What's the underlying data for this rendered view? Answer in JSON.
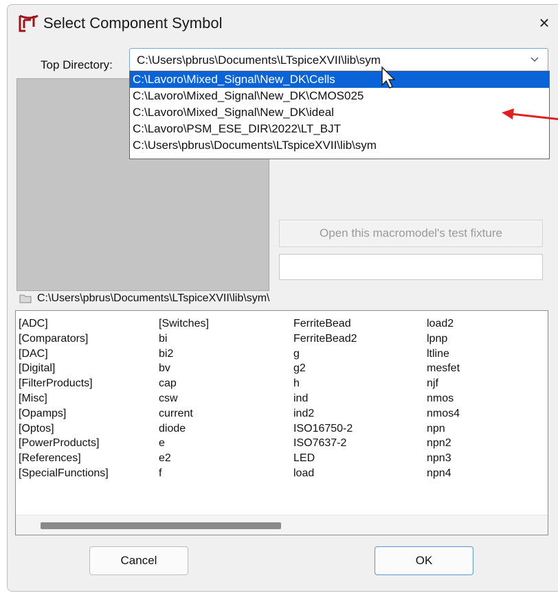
{
  "window": {
    "title": "Select Component Symbol",
    "close_glyph": "×"
  },
  "top_directory": {
    "label": "Top Directory:",
    "value": "C:\\Users\\pbrus\\Documents\\LTspiceXVII\\lib\\sym",
    "options": [
      "C:\\Lavoro\\Mixed_Signal\\New_DK\\Cells",
      "C:\\Lavoro\\Mixed_Signal\\New_DK\\CMOS025",
      "C:\\Lavoro\\Mixed_Signal\\New_DK\\ideal",
      "C:\\Lavoro\\PSM_ESE_DIR\\2022\\LT_BJT",
      "C:\\Users\\pbrus\\Documents\\LTspiceXVII\\lib\\sym"
    ],
    "highlighted_index": 0
  },
  "fixture_button": "Open this macromodel's test fixture",
  "current_path": "C:\\Users\\pbrus\\Documents\\LTspiceXVII\\lib\\sym\\",
  "file_columns": [
    [
      "[ADC]",
      "[Comparators]",
      "[DAC]",
      "[Digital]",
      "[FilterProducts]",
      "[Misc]",
      "[Opamps]",
      "[Optos]",
      "[PowerProducts]",
      "[References]",
      "[SpecialFunctions]"
    ],
    [
      "[Switches]",
      "bi",
      "bi2",
      "bv",
      "cap",
      "csw",
      "current",
      "diode",
      "e",
      "e2",
      "f"
    ],
    [
      "FerriteBead",
      "FerriteBead2",
      "g",
      "g2",
      "h",
      "ind",
      "ind2",
      "ISO16750-2",
      "ISO7637-2",
      "LED",
      "load"
    ],
    [
      "load2",
      "lpnp",
      "ltline",
      "mesfet",
      "njf",
      "nmos",
      "nmos4",
      "npn",
      "npn2",
      "npn3",
      "npn4"
    ]
  ],
  "buttons": {
    "cancel": "Cancel",
    "ok": "OK"
  },
  "colors": {
    "selection": "#0a64d8",
    "annotation_arrow": "#e02020",
    "preview_bg": "#c4c4c4"
  },
  "icons": [
    "ltspice-app-icon",
    "close-icon",
    "chevron-down-icon",
    "folder-icon",
    "mouse-cursor-icon",
    "red-arrow-annotation"
  ]
}
